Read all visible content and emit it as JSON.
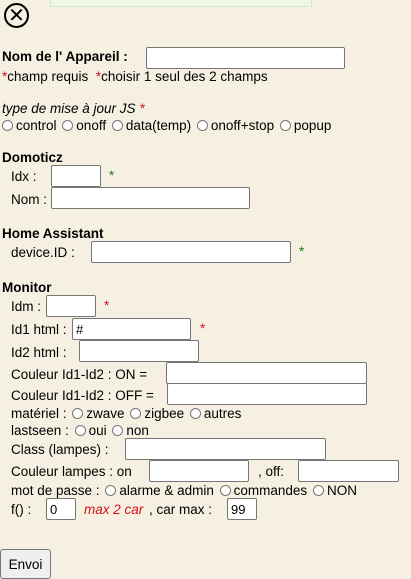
{
  "close": {
    "glyph": "✕"
  },
  "appareil": {
    "label": "Nom de l' Appareil :",
    "required_prefix": "*",
    "required_text": "champ requis",
    "choose_prefix": "*",
    "choose_text": "choisir 1 seul des 2 champs"
  },
  "type_maj": {
    "label": "type de mise à jour JS",
    "star": "*",
    "options": [
      "control",
      "onoff",
      "data(temp)",
      "onoff+stop",
      "popup"
    ]
  },
  "domoticz": {
    "title": "Domoticz",
    "idx_label": "Idx :",
    "idx_star": "*",
    "nom_label": "Nom :"
  },
  "home_assistant": {
    "title": "Home Assistant",
    "device_label": "device.ID :",
    "device_star": "*"
  },
  "monitor": {
    "title": "Monitor",
    "idm_label": "Idm :",
    "idm_star": "*",
    "id1_label": "Id1 html :",
    "id1_value": "#",
    "id1_star": "*",
    "id2_label": "Id2 html :",
    "on_label": "Couleur Id1-Id2 : ON =",
    "off_label": "Couleur Id1-Id2 : OFF =",
    "materiel_label": "matériel :",
    "materiel_options": [
      "zwave",
      "zigbee",
      "autres"
    ],
    "lastseen_label": "lastseen :",
    "lastseen_options": [
      "oui",
      "non"
    ],
    "class_label": "Class (lampes) :",
    "lampes_on_label": "Couleur lampes : on",
    "lampes_off_label": ", off:",
    "mdp_label": "mot de passe :",
    "mdp_options": [
      "alarme & admin",
      "commandes",
      "NON"
    ],
    "f_label": "f() :",
    "f_value": "0",
    "max_car_text": "max 2 car",
    "car_max_label": ", car max :",
    "car_max_value": "99"
  },
  "submit_label": "Envoi"
}
